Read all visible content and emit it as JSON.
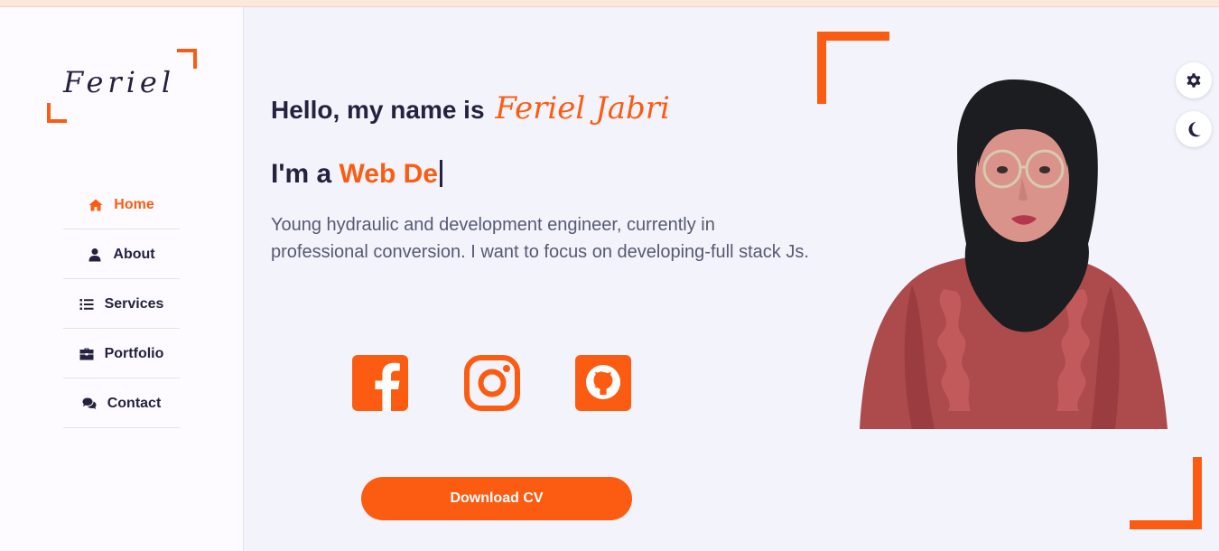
{
  "brand": {
    "logo_text": "Feriel",
    "accent": "#fb5c12",
    "dark": "#24223f"
  },
  "nav": [
    {
      "label": "Home",
      "icon": "home-icon",
      "active": true
    },
    {
      "label": "About",
      "icon": "user-icon",
      "active": false
    },
    {
      "label": "Services",
      "icon": "list-icon",
      "active": false
    },
    {
      "label": "Portfolio",
      "icon": "briefcase-icon",
      "active": false
    },
    {
      "label": "Contact",
      "icon": "chat-icon",
      "active": false
    }
  ],
  "hero": {
    "greeting": "Hello, my name is",
    "name": "Feriel Jabri",
    "role_prefix": "I'm a",
    "role_typed": "Web De",
    "description": "Young hydraulic and development engineer, currently in professional conversion. I want to focus on developing-full stack Js."
  },
  "social": [
    {
      "icon": "facebook-icon"
    },
    {
      "icon": "instagram-icon"
    },
    {
      "icon": "github-icon"
    }
  ],
  "cta": {
    "download_label": "Download CV"
  },
  "toggles": [
    {
      "icon": "gear-icon"
    },
    {
      "icon": "moon-icon"
    }
  ]
}
